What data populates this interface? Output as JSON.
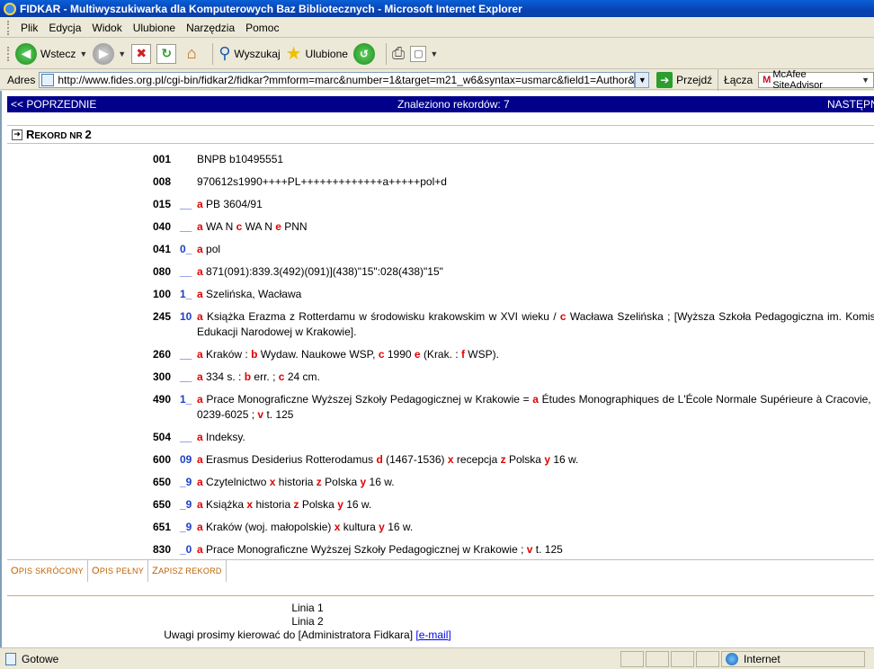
{
  "window": {
    "title": "FIDKAR - Multiwyszukiwarka dla Komputerowych Baz Bibliotecznych - Microsoft Internet Explorer"
  },
  "menu": [
    "Plik",
    "Edycja",
    "Widok",
    "Ulubione",
    "Narzędzia",
    "Pomoc"
  ],
  "toolbar": {
    "back_label": "Wstecz",
    "search_label": "Wyszukaj",
    "favorites_label": "Ulubione"
  },
  "address": {
    "label": "Adres",
    "url": "http://www.fides.org.pl/cgi-bin/fidkar2/fidkar?mmform=marc&number=1&target=m21_w6&syntax=usmarc&field1=Author&field2=Ti",
    "go_label": "Przejdź",
    "links_label": "Łącza",
    "mcafee_label": "McAfee SiteAdvisor"
  },
  "nav": {
    "prev": "<< POPRZEDNIE",
    "found": "Znaleziono rekordów: 7",
    "next": "NASTĘPN"
  },
  "record": {
    "first": "R",
    "rest": "EKORD NR ",
    "number": "2"
  },
  "marc": [
    {
      "tag": "001",
      "ind": "",
      "parts": [
        {
          "t": "BNPB b10495551"
        }
      ]
    },
    {
      "tag": "008",
      "ind": "",
      "parts": [
        {
          "t": "970612s1990++++PL+++++++++++++a+++++pol+d"
        }
      ]
    },
    {
      "tag": "015",
      "ind": "__",
      "parts": [
        {
          "s": "a"
        },
        {
          "t": "PB 3604/91"
        }
      ]
    },
    {
      "tag": "040",
      "ind": "__",
      "parts": [
        {
          "s": "a"
        },
        {
          "t": "WA N"
        },
        {
          "s": "c"
        },
        {
          "t": "WA N"
        },
        {
          "s": "e"
        },
        {
          "t": "PNN"
        }
      ]
    },
    {
      "tag": "041",
      "ind": "0_",
      "parts": [
        {
          "s": "a"
        },
        {
          "t": "pol"
        }
      ]
    },
    {
      "tag": "080",
      "ind": "__",
      "parts": [
        {
          "s": "a"
        },
        {
          "t": "871(091):839.3(492)(091)](438)\"15\":028(438)\"15\""
        }
      ]
    },
    {
      "tag": "100",
      "ind": "1_",
      "parts": [
        {
          "s": "a"
        },
        {
          "t": "Szelińska, Wacława"
        }
      ]
    },
    {
      "tag": "245",
      "ind": "10",
      "wrap": true,
      "parts": [
        {
          "s": "a"
        },
        {
          "t": "Książka Erazma z Rotterdamu w środowisku krakowskim w XVI wieku /"
        },
        {
          "s": "c"
        },
        {
          "t": "Wacława Szelińska ; [Wyższa Szkoła Pedagogiczna im. Komisji Edukacji Narodowej w Krakowie]."
        }
      ]
    },
    {
      "tag": "260",
      "ind": "__",
      "parts": [
        {
          "s": "a"
        },
        {
          "t": "Kraków :"
        },
        {
          "s": "b"
        },
        {
          "t": "Wydaw. Naukowe WSP,"
        },
        {
          "s": "c"
        },
        {
          "t": "1990"
        },
        {
          "s": "e"
        },
        {
          "t": "(Krak. :"
        },
        {
          "s": "f"
        },
        {
          "t": "WSP)."
        }
      ]
    },
    {
      "tag": "300",
      "ind": "__",
      "parts": [
        {
          "s": "a"
        },
        {
          "t": "334 s. :"
        },
        {
          "s": "b"
        },
        {
          "t": "err. ;"
        },
        {
          "s": "c"
        },
        {
          "t": "24 cm."
        }
      ]
    },
    {
      "tag": "490",
      "ind": "1_",
      "wrap": true,
      "parts": [
        {
          "s": "a"
        },
        {
          "t": "Prace Monograficzne Wyższej Szkoły Pedagogicznej w Krakowie ="
        },
        {
          "s": "a"
        },
        {
          "t": "Études Monographiques de L'École Normale Supérieure à Cracovie,"
        },
        {
          "s": "x"
        },
        {
          "t": "0239-6025 ;"
        },
        {
          "s": "v"
        },
        {
          "t": "t. 125"
        }
      ]
    },
    {
      "tag": "504",
      "ind": "__",
      "parts": [
        {
          "s": "a"
        },
        {
          "t": "Indeksy."
        }
      ]
    },
    {
      "tag": "600",
      "ind": "09",
      "parts": [
        {
          "s": "a"
        },
        {
          "t": "Erasmus Desiderius Rotterodamus"
        },
        {
          "s": "d"
        },
        {
          "t": "(1467-1536)"
        },
        {
          "s": "x"
        },
        {
          "t": "recepcja"
        },
        {
          "s": "z"
        },
        {
          "t": "Polska"
        },
        {
          "s": "y"
        },
        {
          "t": "16 w."
        }
      ]
    },
    {
      "tag": "650",
      "ind": "_9",
      "parts": [
        {
          "s": "a"
        },
        {
          "t": "Czytelnictwo"
        },
        {
          "s": "x"
        },
        {
          "t": "historia"
        },
        {
          "s": "z"
        },
        {
          "t": "Polska"
        },
        {
          "s": "y"
        },
        {
          "t": "16 w."
        }
      ]
    },
    {
      "tag": "650",
      "ind": "_9",
      "parts": [
        {
          "s": "a"
        },
        {
          "t": "Książka"
        },
        {
          "s": "x"
        },
        {
          "t": "historia"
        },
        {
          "s": "z"
        },
        {
          "t": "Polska"
        },
        {
          "s": "y"
        },
        {
          "t": "16 w."
        }
      ]
    },
    {
      "tag": "651",
      "ind": "_9",
      "parts": [
        {
          "s": "a"
        },
        {
          "t": "Kraków (woj. małopolskie)"
        },
        {
          "s": "x"
        },
        {
          "t": "kultura"
        },
        {
          "s": "y"
        },
        {
          "t": "16 w."
        }
      ]
    },
    {
      "tag": "830",
      "ind": "_0",
      "parts": [
        {
          "s": "a"
        },
        {
          "t": "Prace Monograficzne Wyższej Szkoły Pedagogicznej w Krakowie ;"
        },
        {
          "s": "v"
        },
        {
          "t": "t. 125"
        }
      ]
    }
  ],
  "bottom_tabs": [
    {
      "first": "O",
      "rest": "PIS SKRÓCONY"
    },
    {
      "first": "O",
      "rest": "PIS PEŁNY"
    },
    {
      "first": "Z",
      "rest": "APISZ REKORD"
    }
  ],
  "footer": {
    "line1": "Linia 1",
    "line2": "Linia 2",
    "contact_text": "Uwagi prosimy kierować do [Administratora Fidkara]",
    "email_link": "[e-mail]"
  },
  "status": {
    "text": "Gotowe",
    "zone": "Internet"
  }
}
